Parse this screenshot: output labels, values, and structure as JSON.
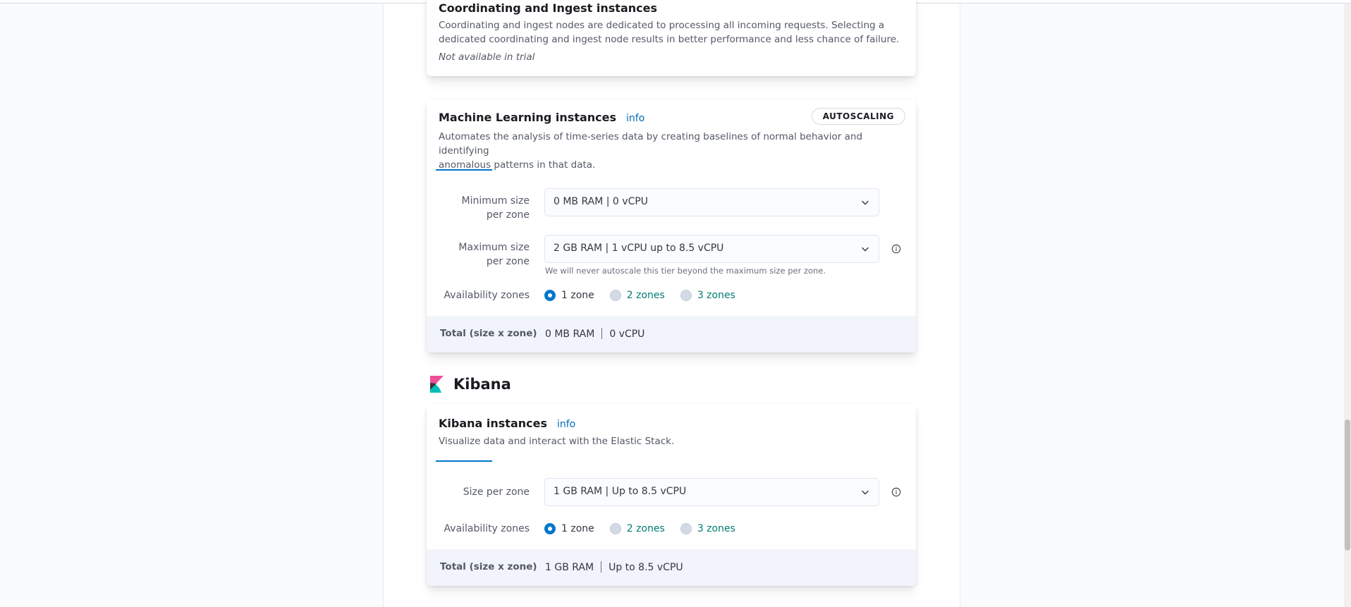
{
  "coordinating": {
    "title": "Coordinating and Ingest instances",
    "desc_line1": "Coordinating and ingest nodes are dedicated to processing all incoming requests. Selecting a",
    "desc_line2": "dedicated coordinating and ingest node results in better performance and less chance of failure.",
    "not_available": "Not available in trial"
  },
  "ml": {
    "title": "Machine Learning instances",
    "info": "info",
    "badge": "AUTOSCALING",
    "desc_line1": "Automates the analysis of time-series data by creating baselines of normal behavior and identifying",
    "desc_line2": "anomalous patterns in that data.",
    "min_label_line1": "Minimum size",
    "min_label_line2": "per zone",
    "min_value": "0 MB RAM | 0 vCPU",
    "max_label_line1": "Maximum size",
    "max_label_line2": "per zone",
    "max_value": "2 GB RAM | 1 vCPU up to 8.5 vCPU",
    "max_help": "We will never autoscale this tier beyond the maximum size per zone.",
    "zones_label": "Availability zones",
    "zones": [
      "1 zone",
      "2 zones",
      "3 zones"
    ],
    "zones_selected": 0,
    "total_label": "Total (size x zone)",
    "total_ram": "0 MB RAM",
    "total_cpu": "0 vCPU"
  },
  "kibana_section": {
    "title": "Kibana",
    "logo": "kibana-logo"
  },
  "kibana": {
    "title": "Kibana instances",
    "info": "info",
    "desc": "Visualize data and interact with the Elastic Stack.",
    "size_label": "Size per zone",
    "size_value": "1 GB RAM | Up to 8.5 vCPU",
    "zones_label": "Availability zones",
    "zones": [
      "1 zone",
      "2 zones",
      "3 zones"
    ],
    "zones_selected": 0,
    "total_label": "Total (size x zone)",
    "total_ram": "1 GB RAM",
    "total_cpu": "Up to 8.5 vCPU"
  },
  "colors": {
    "primary": "#0077cc",
    "link": "#006bb8",
    "success_link": "#017d73",
    "text": "#343741",
    "subdued": "#535966",
    "total_bg": "#f1f4fa"
  },
  "icons": {
    "chevron": "chevron-down-icon",
    "info": "info-circle-icon"
  }
}
